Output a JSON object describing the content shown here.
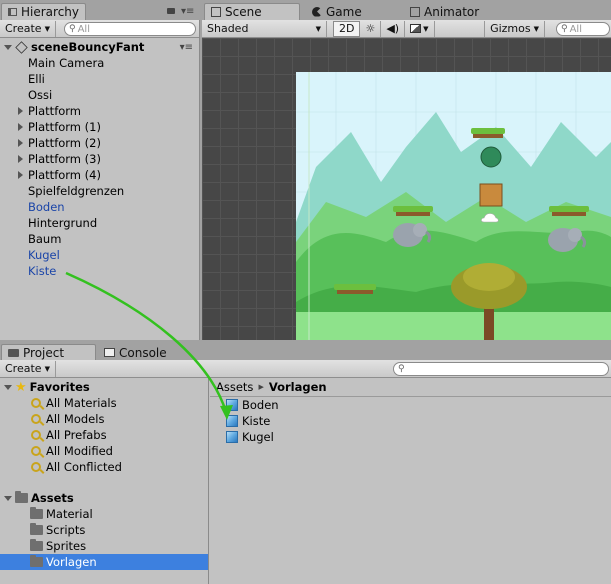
{
  "hierarchy": {
    "tab_label": "Hierarchy",
    "create_label": "Create",
    "search_placeholder": "All",
    "scene_name": "sceneBouncyFant",
    "items": [
      {
        "label": "Main Camera",
        "expandable": false,
        "style": "normal"
      },
      {
        "label": "Elli",
        "expandable": false,
        "style": "normal"
      },
      {
        "label": "Ossi",
        "expandable": false,
        "style": "normal"
      },
      {
        "label": "Plattform",
        "expandable": true,
        "style": "normal"
      },
      {
        "label": "Plattform (1)",
        "expandable": true,
        "style": "normal"
      },
      {
        "label": "Plattform (2)",
        "expandable": true,
        "style": "normal"
      },
      {
        "label": "Plattform (3)",
        "expandable": true,
        "style": "normal"
      },
      {
        "label": "Plattform (4)",
        "expandable": true,
        "style": "normal"
      },
      {
        "label": "Spielfeldgrenzen",
        "expandable": false,
        "style": "normal"
      },
      {
        "label": "Boden",
        "expandable": false,
        "style": "prefab"
      },
      {
        "label": "Hintergrund",
        "expandable": false,
        "style": "normal"
      },
      {
        "label": "Baum",
        "expandable": false,
        "style": "normal"
      },
      {
        "label": "Kugel",
        "expandable": false,
        "style": "prefab"
      },
      {
        "label": "Kiste",
        "expandable": false,
        "style": "prefab"
      }
    ]
  },
  "scene": {
    "tabs": [
      {
        "label": "Scene",
        "active": true
      },
      {
        "label": "Game",
        "active": false
      },
      {
        "label": "Animator",
        "active": false
      }
    ],
    "shading_mode": "Shaded",
    "mode_2d": "2D",
    "gizmos_label": "Gizmos",
    "search_placeholder": "All"
  },
  "project": {
    "tabs": [
      {
        "label": "Project",
        "active": true
      },
      {
        "label": "Console",
        "active": false
      }
    ],
    "create_label": "Create",
    "favorites_label": "Favorites",
    "favorites": [
      "All Materials",
      "All Models",
      "All Prefabs",
      "All Modified",
      "All Conflicted"
    ],
    "assets_label": "Assets",
    "folders": [
      {
        "label": "Material",
        "selected": false
      },
      {
        "label": "Scripts",
        "selected": false
      },
      {
        "label": "Sprites",
        "selected": false
      },
      {
        "label": "Vorlagen",
        "selected": true
      }
    ],
    "breadcrumb": {
      "root": "Assets",
      "separator": "▶",
      "current": "Vorlagen"
    },
    "assets": [
      "Boden",
      "Kiste",
      "Kugel"
    ]
  },
  "colors": {
    "selection": "#3d80df",
    "prefab_text": "#1b45a8",
    "arrow": "#33c11f",
    "sky": "#d9f4fb"
  }
}
